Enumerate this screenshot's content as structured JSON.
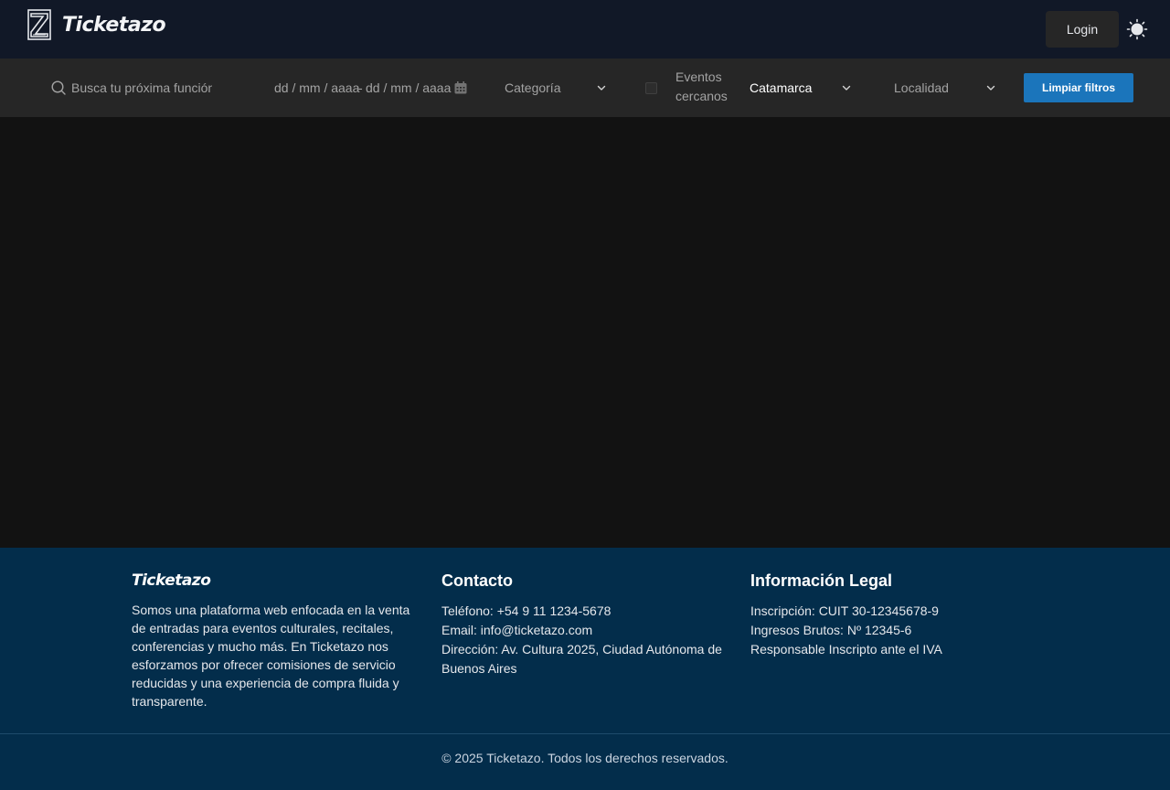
{
  "header": {
    "brand": "Ticketazo",
    "login_label": "Login",
    "icons": {
      "logo": "z-logo-icon",
      "theme": "sun-icon"
    }
  },
  "filters": {
    "search_placeholder": "Busca tu próxima función",
    "date_from_placeholder": "dd / mm / aaaa",
    "date_separator": "-",
    "date_to_placeholder": "dd / mm / aaaa",
    "category_label": "Categoría",
    "nearby_label": "Eventos cercanos",
    "nearby_checked": false,
    "province_value": "Catamarca",
    "locality_label": "Localidad",
    "clear_label": "Limpiar filtros",
    "icons": {
      "search": "search-icon",
      "calendar": "calendar-icon",
      "chevron": "chevron-down-icon"
    }
  },
  "footer": {
    "about": {
      "title": "Ticketazo",
      "text": "Somos una plataforma web enfocada en la venta de entradas para eventos culturales, recitales, conferencias y mucho más. En Ticketazo nos esforzamos por ofrecer comisiones de servicio reducidas y una experiencia de compra fluida y transparente."
    },
    "contact": {
      "title": "Contacto",
      "phone": "Teléfono: +54 9 11 1234-5678",
      "email": "Email: info@ticketazo.com",
      "address": "Dirección: Av. Cultura 2025, Ciudad Autónoma de Buenos Aires"
    },
    "legal": {
      "title": "Información Legal",
      "inscription": "Inscripción: CUIT 30-12345678-9",
      "gross_income": "Ingresos Brutos: Nº 12345-6",
      "iva": "Responsable Inscripto ante el IVA"
    },
    "copyright": "© 2025 Ticketazo. Todos los derechos reservados."
  },
  "colors": {
    "header_bg": "#111827",
    "filter_bg": "#262626",
    "main_bg": "#121212",
    "footer_bg": "#032d4b",
    "accent": "#1b75bb"
  }
}
